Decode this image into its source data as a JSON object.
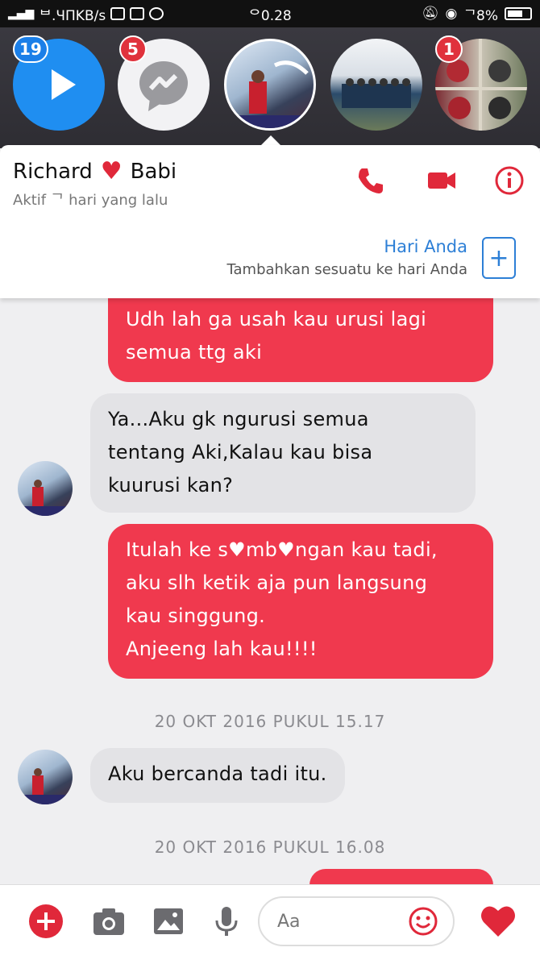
{
  "status_bar": {
    "left": "ᄇ.ЧΠKB/s",
    "time": "ᄋ0.28",
    "battery": "ᄀ8%"
  },
  "chat_heads": [
    {
      "badge": "19",
      "kind": "video"
    },
    {
      "badge": "5",
      "kind": "messenger"
    },
    {
      "badge": "",
      "kind": "photo"
    },
    {
      "badge": "",
      "kind": "photo"
    },
    {
      "badge": "1",
      "kind": "photo"
    }
  ],
  "header": {
    "name_first": "Richard",
    "name_second": "Babi",
    "status": "Aktif ᄀ hari yang lalu"
  },
  "your_day": {
    "title": "Hari Anda",
    "subtitle": "Tambahkan sesuatu ke hari Anda",
    "add_symbol": "+"
  },
  "messages": [
    {
      "type": "out",
      "text": "Udh lah ga usah kau urusi lagi\nsemua ttg aki"
    },
    {
      "type": "in",
      "text": "Ya...Aku gk ngurusi semua\ntentang Aki,Kalau kau bisa\nkuurusi kan?"
    },
    {
      "type": "out",
      "text": "Itulah ke s♥mb♥ngan kau tadi,\naku slh ketik aja pun langsung\nkau singgung.\nAnjeeng lah kau!!!!"
    },
    {
      "type": "timestamp",
      "text": "20 OKT 2016 PUKUL 15.17"
    },
    {
      "type": "in",
      "text": "Aku bercanda tadi itu."
    },
    {
      "type": "timestamp",
      "text": "20 OKT 2016 PUKUL 16.08"
    }
  ],
  "composer": {
    "placeholder": "Aa"
  },
  "colors": {
    "accent": "#f0394e",
    "blue": "#2d7fd6",
    "incoming": "#e3e3e6"
  }
}
